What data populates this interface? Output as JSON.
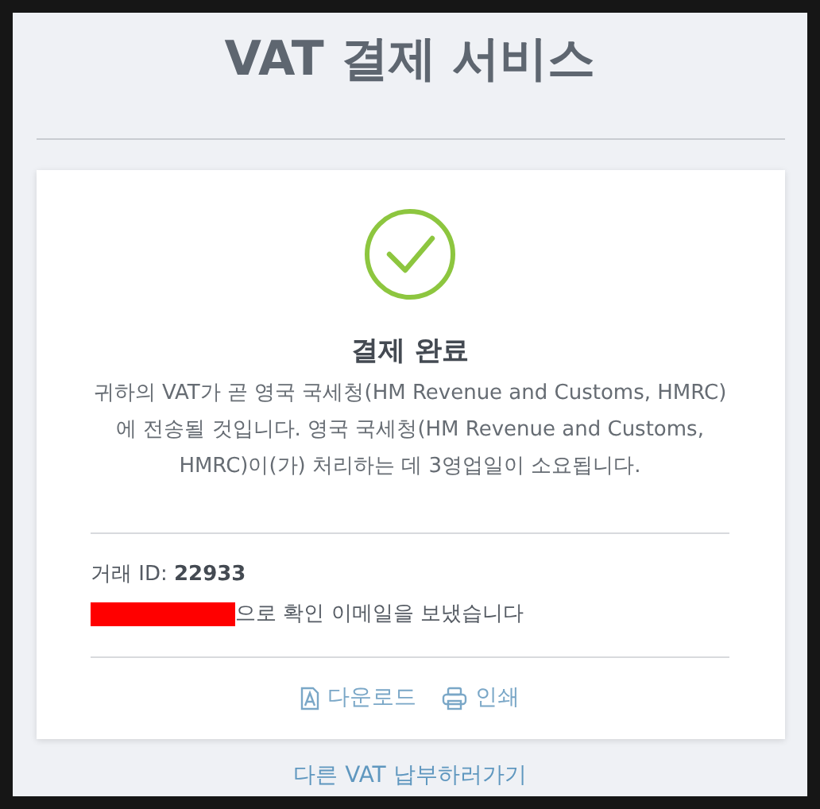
{
  "page": {
    "title": "VAT 결제 서비스"
  },
  "result": {
    "heading": "결제 완료",
    "message": "귀하의 VAT가 곧 영국 국세청(HM Revenue and Customs, HMRC)에 전송될 것입니다. 영국 국세청(HM Revenue and Customs, HMRC)이(가) 처리하는 데 3영업일이 소요됩니다.",
    "transaction": "거래 ID: **22933**",
    "email_note": "으로 확인 이메일을 보냈습니다"
  },
  "actions": [
    {
      "kind": "download",
      "label": "다운로드"
    },
    {
      "kind": "print",
      "label": "인쇄"
    }
  ],
  "footer_link": "다른 VAT 납부하러가기"
}
